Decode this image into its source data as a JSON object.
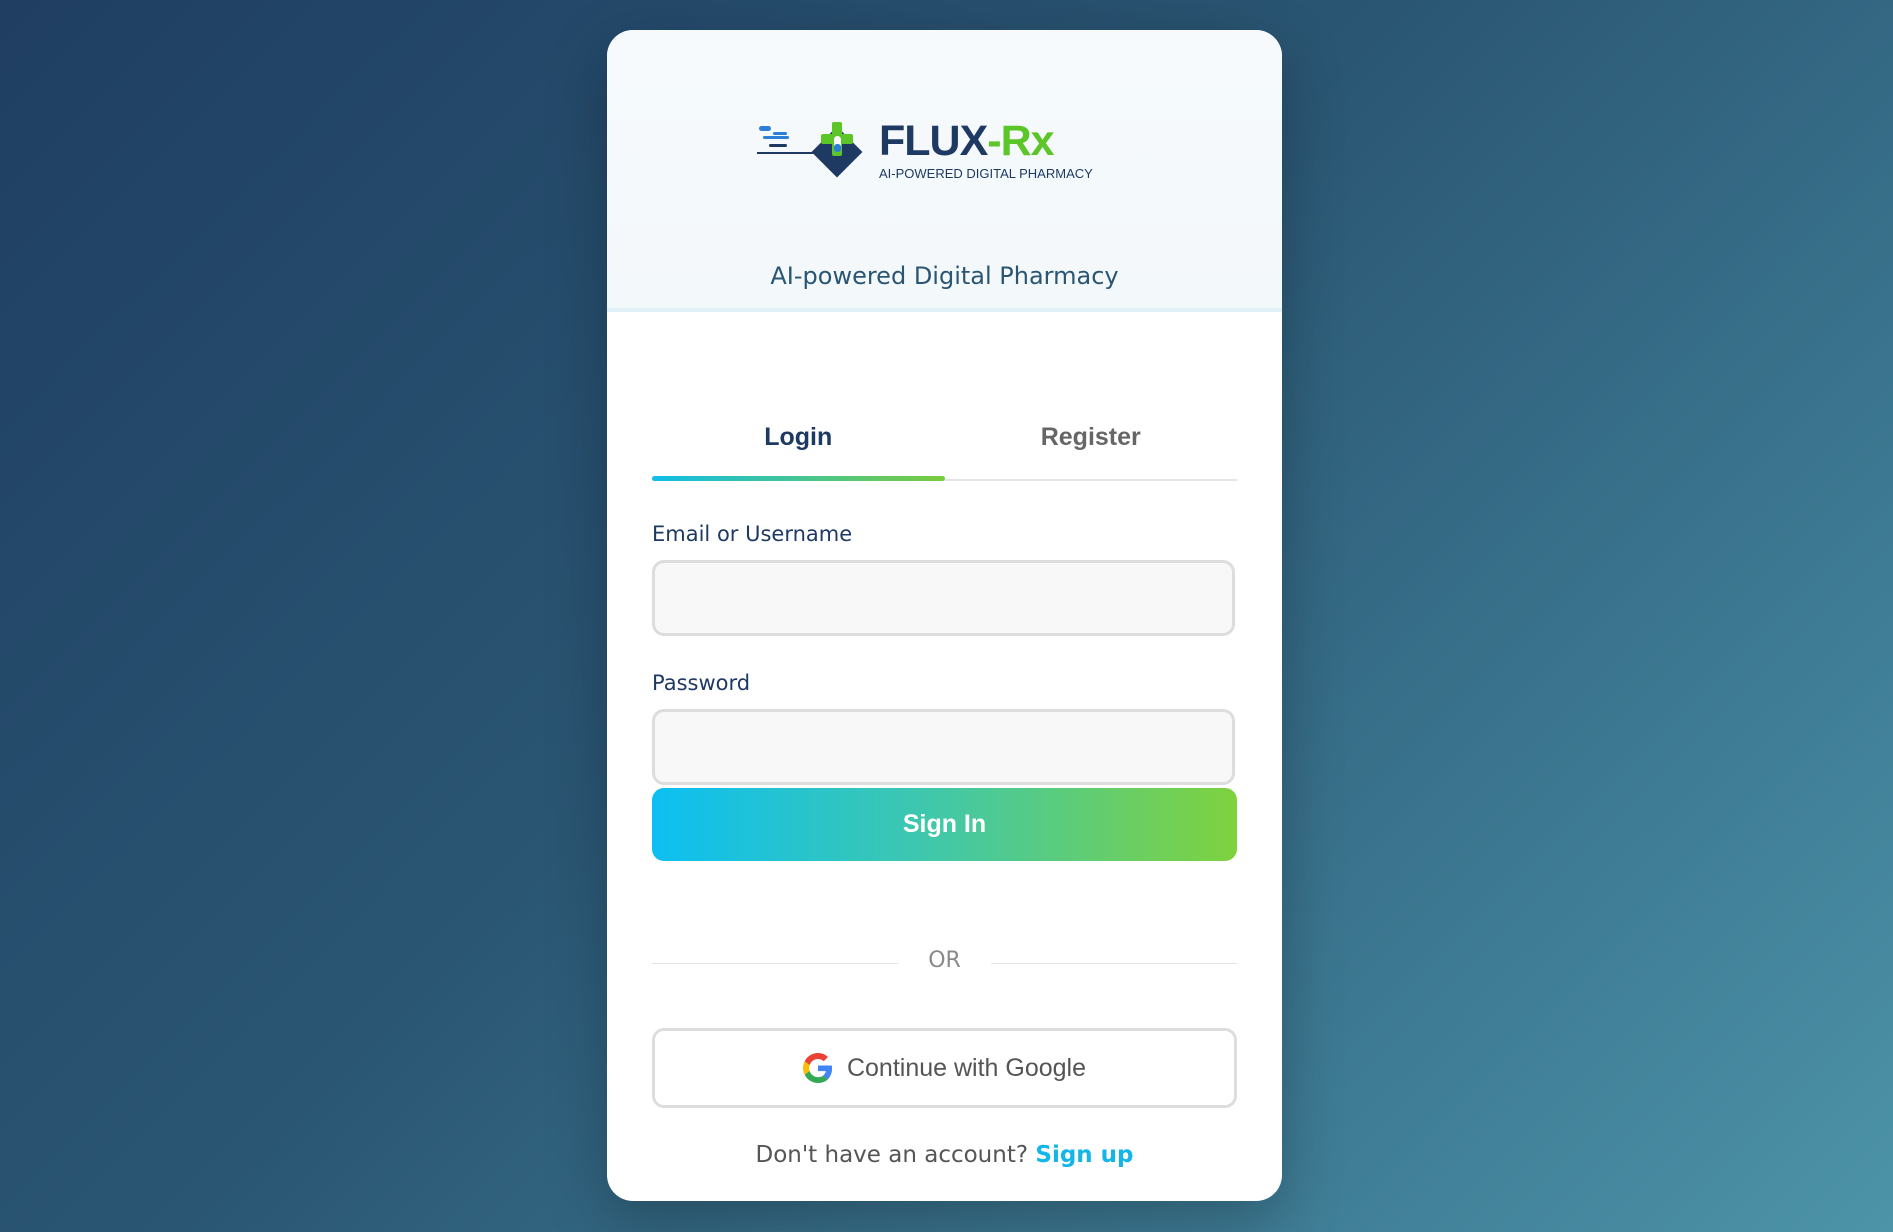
{
  "brand": {
    "name_main": "FLUX",
    "name_accent": "-Rx",
    "subtitle": "AI-POWERED DIGITAL PHARMACY",
    "tagline": "AI-powered Digital Pharmacy",
    "colors": {
      "navy": "#1e3a63",
      "green": "#5cc527",
      "cyan": "#12b6e8"
    }
  },
  "tabs": [
    {
      "label": "Login",
      "active": true
    },
    {
      "label": "Register",
      "active": false
    }
  ],
  "form": {
    "email_label": "Email or Username",
    "email_value": "",
    "password_label": "Password",
    "password_value": "",
    "submit_label": "Sign In"
  },
  "divider": {
    "text": "OR"
  },
  "google": {
    "label": "Continue with Google",
    "icon": "google-icon"
  },
  "footer": {
    "prompt": "Don't have an account?",
    "link": "Sign up"
  }
}
